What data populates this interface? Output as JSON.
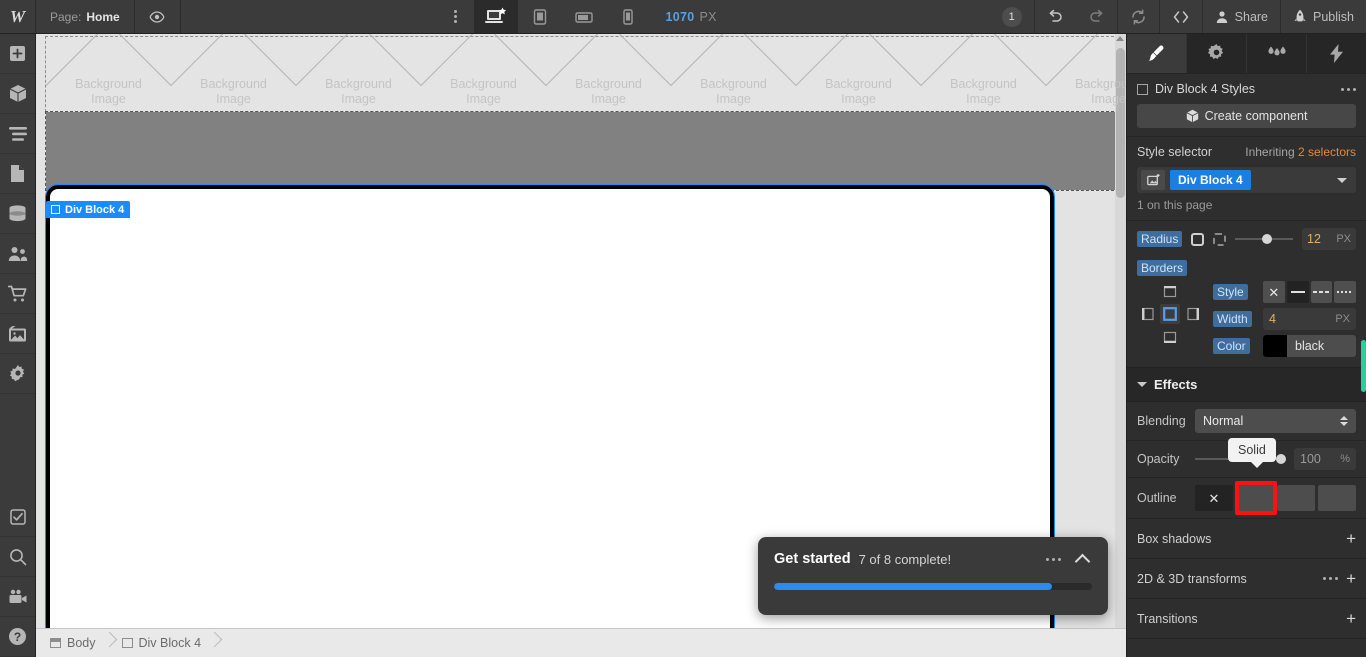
{
  "topbar": {
    "logo": "W",
    "page_label": "Page:",
    "page_name": "Home",
    "preview_icon": "eye-icon",
    "more_icon": "more-vertical-icon",
    "devices": [
      {
        "name": "desktop",
        "label": "Desktop",
        "active": true
      },
      {
        "name": "tablet",
        "label": "Tablet",
        "active": false
      },
      {
        "name": "mobile-landscape",
        "label": "Mobile landscape",
        "active": false
      },
      {
        "name": "mobile-portrait",
        "label": "Mobile portrait",
        "active": false
      }
    ],
    "viewport_value": "1070",
    "viewport_unit": "PX",
    "notification_count": "1",
    "undo_icon": "undo-icon",
    "redo_icon": "redo-icon",
    "sync_icon": "refresh-icon",
    "code_icon": "code-icon",
    "share_label": "Share",
    "publish_label": "Publish"
  },
  "leftbar": {
    "items": [
      {
        "name": "add-elements",
        "icon": "plus-square-icon"
      },
      {
        "name": "components",
        "icon": "cube-icon"
      },
      {
        "name": "navigator",
        "icon": "layers-icon"
      },
      {
        "name": "pages",
        "icon": "page-icon"
      },
      {
        "name": "cms",
        "icon": "database-icon"
      },
      {
        "name": "users",
        "icon": "people-icon"
      },
      {
        "name": "ecommerce",
        "icon": "cart-icon"
      },
      {
        "name": "assets",
        "icon": "images-icon"
      },
      {
        "name": "settings",
        "icon": "gear-icon"
      }
    ],
    "bottom_items": [
      {
        "name": "audit",
        "icon": "checkbox-icon"
      },
      {
        "name": "search",
        "icon": "search-icon"
      },
      {
        "name": "video",
        "icon": "video-camera-icon"
      },
      {
        "name": "help",
        "icon": "question-circle-icon"
      }
    ]
  },
  "canvas": {
    "background_tiles": [
      "Background Image",
      "Background Image",
      "Background Image",
      "Background Image",
      "Background Image",
      "Background Image",
      "Background Image",
      "Background Image",
      "Background Image"
    ],
    "tile_line1": "Background",
    "tile_line2": "Image",
    "selected_element_tag": "Div Block 4"
  },
  "toast": {
    "title": "Get started",
    "subtitle": "7 of 8 complete!",
    "more_icon": "more-horizontal-icon",
    "collapse_icon": "chevron-up-icon",
    "progress_percent": 87.5,
    "progress_color": "#2b8cf0"
  },
  "breadcrumb": {
    "items": [
      {
        "label": "Body",
        "icon": "window-icon"
      },
      {
        "label": "Div Block 4",
        "icon": "square-icon"
      }
    ]
  },
  "rightpanel": {
    "tabs": [
      {
        "name": "style",
        "icon": "brush-icon",
        "active": true
      },
      {
        "name": "settings",
        "icon": "gear-icon",
        "active": false
      },
      {
        "name": "interactions",
        "icon": "droplets-icon",
        "active": false
      },
      {
        "name": "effects",
        "icon": "lightning-icon",
        "active": false
      }
    ],
    "styles_header": "Div Block 4 Styles",
    "styles_more_icon": "more-horizontal-icon",
    "create_component_label": "Create component",
    "create_component_icon": "cube-icon",
    "style_selector_label": "Style selector",
    "inheriting_label": "Inheriting",
    "inheriting_count": "2 selectors",
    "selector_chip": "Div Block 4",
    "on_this_page": "1 on this page",
    "radius": {
      "label": "Radius",
      "value": "12",
      "unit": "PX",
      "slider_percent": 55
    },
    "borders": {
      "label": "Borders",
      "style_label": "Style",
      "style_options": [
        "none",
        "solid",
        "dashed",
        "dotted"
      ],
      "style_selected": "solid",
      "width_label": "Width",
      "width_value": "4",
      "width_unit": "PX",
      "color_label": "Color",
      "color_value": "black",
      "color_hex": "#000000",
      "side_selected": "all"
    },
    "effects": {
      "title": "Effects",
      "blending_label": "Blending",
      "blending_value": "Normal",
      "opacity_label": "Opacity",
      "opacity_value": "100",
      "opacity_unit": "%",
      "opacity_percent": 100,
      "outline_label": "Outline",
      "outline_options": [
        "none",
        "solid",
        "dashed",
        "dotted"
      ],
      "outline_selected": "solid",
      "outline_tooltip": "Solid",
      "highlight_color": "#ff1111"
    },
    "sections": [
      {
        "label": "Box shadows",
        "has_more": false,
        "add_icon": "plus-icon"
      },
      {
        "label": "2D & 3D transforms",
        "has_more": true,
        "add_icon": "plus-icon"
      },
      {
        "label": "Transitions",
        "has_more": false,
        "add_icon": "plus-icon"
      }
    ]
  }
}
